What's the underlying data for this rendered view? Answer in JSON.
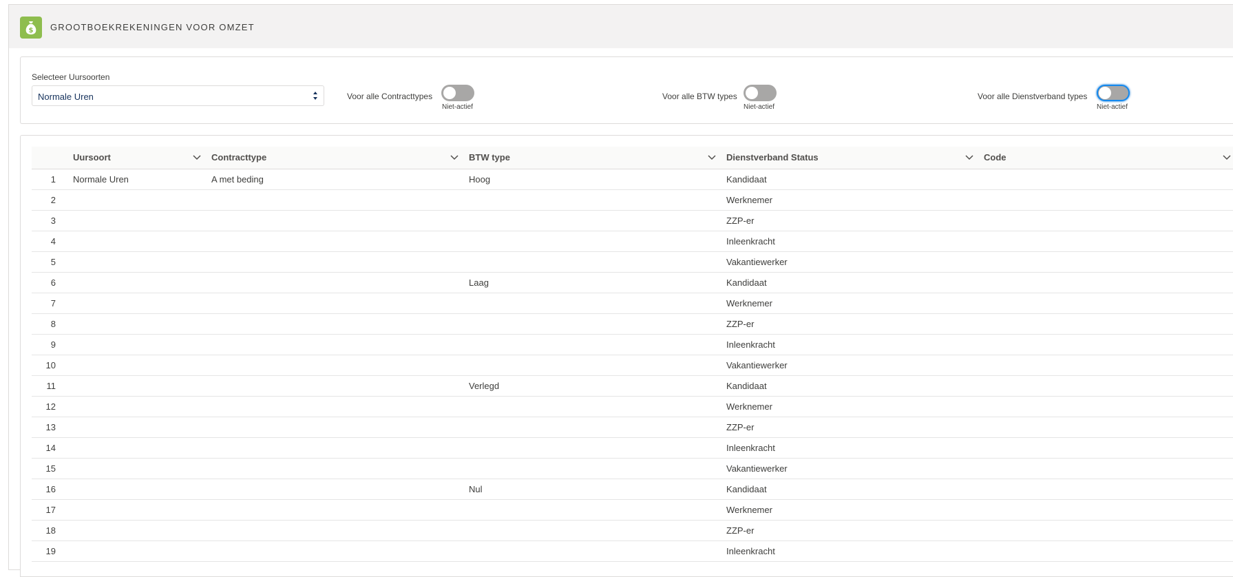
{
  "header": {
    "title": "GROOTBOEKREKENINGEN VOOR OMZET",
    "icon": "money-bag-icon",
    "icon_color": "#8ebd4e"
  },
  "filters": {
    "select_label": "Selecteer Uursoorten",
    "select_value": "Normale Uren",
    "toggles": [
      {
        "label": "Voor alle Contracttypes",
        "state": "Niet-actief"
      },
      {
        "label": "Voor alle BTW types",
        "state": "Niet-actief"
      },
      {
        "label": "Voor alle Dienstverband types",
        "state": "Niet-actief"
      }
    ]
  },
  "table": {
    "columns": [
      "Uursoort",
      "Contracttype",
      "BTW type",
      "Dienstverband Status",
      "Code"
    ],
    "rows": [
      {
        "n": "1",
        "uursoort": "Normale Uren",
        "contracttype": "A met beding",
        "btw": "Hoog",
        "status": "Kandidaat",
        "code": ""
      },
      {
        "n": "2",
        "uursoort": "",
        "contracttype": "",
        "btw": "",
        "status": "Werknemer",
        "code": ""
      },
      {
        "n": "3",
        "uursoort": "",
        "contracttype": "",
        "btw": "",
        "status": "ZZP-er",
        "code": ""
      },
      {
        "n": "4",
        "uursoort": "",
        "contracttype": "",
        "btw": "",
        "status": "Inleenkracht",
        "code": ""
      },
      {
        "n": "5",
        "uursoort": "",
        "contracttype": "",
        "btw": "",
        "status": "Vakantiewerker",
        "code": ""
      },
      {
        "n": "6",
        "uursoort": "",
        "contracttype": "",
        "btw": "Laag",
        "status": "Kandidaat",
        "code": ""
      },
      {
        "n": "7",
        "uursoort": "",
        "contracttype": "",
        "btw": "",
        "status": "Werknemer",
        "code": ""
      },
      {
        "n": "8",
        "uursoort": "",
        "contracttype": "",
        "btw": "",
        "status": "ZZP-er",
        "code": ""
      },
      {
        "n": "9",
        "uursoort": "",
        "contracttype": "",
        "btw": "",
        "status": "Inleenkracht",
        "code": ""
      },
      {
        "n": "10",
        "uursoort": "",
        "contracttype": "",
        "btw": "",
        "status": "Vakantiewerker",
        "code": ""
      },
      {
        "n": "11",
        "uursoort": "",
        "contracttype": "",
        "btw": "Verlegd",
        "status": "Kandidaat",
        "code": ""
      },
      {
        "n": "12",
        "uursoort": "",
        "contracttype": "",
        "btw": "",
        "status": "Werknemer",
        "code": ""
      },
      {
        "n": "13",
        "uursoort": "",
        "contracttype": "",
        "btw": "",
        "status": "ZZP-er",
        "code": ""
      },
      {
        "n": "14",
        "uursoort": "",
        "contracttype": "",
        "btw": "",
        "status": "Inleenkracht",
        "code": ""
      },
      {
        "n": "15",
        "uursoort": "",
        "contracttype": "",
        "btw": "",
        "status": "Vakantiewerker",
        "code": ""
      },
      {
        "n": "16",
        "uursoort": "",
        "contracttype": "",
        "btw": "Nul",
        "status": "Kandidaat",
        "code": ""
      },
      {
        "n": "17",
        "uursoort": "",
        "contracttype": "",
        "btw": "",
        "status": "Werknemer",
        "code": ""
      },
      {
        "n": "18",
        "uursoort": "",
        "contracttype": "",
        "btw": "",
        "status": "ZZP-er",
        "code": ""
      },
      {
        "n": "19",
        "uursoort": "",
        "contracttype": "",
        "btw": "",
        "status": "Inleenkracht",
        "code": ""
      }
    ]
  }
}
